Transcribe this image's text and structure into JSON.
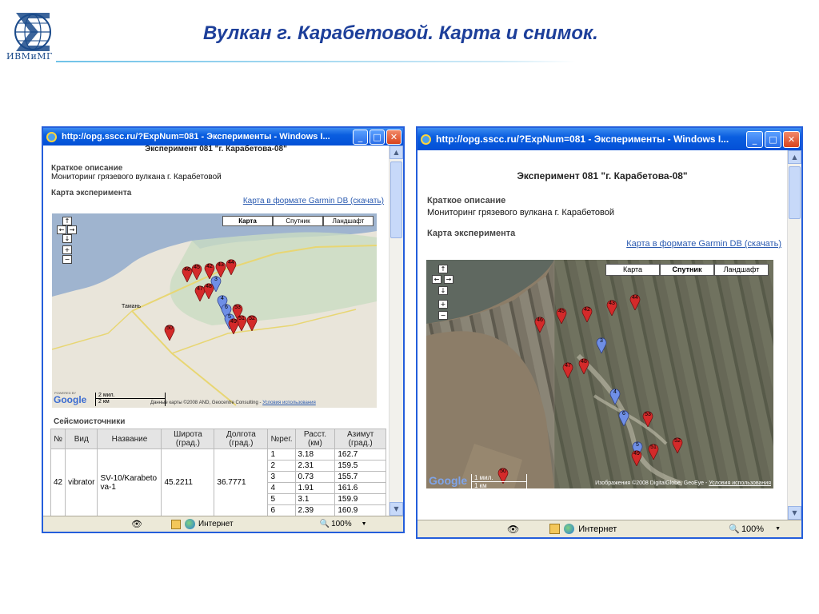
{
  "slide": {
    "title": "Вулкан г. Карабетовой. Карта и снимок.",
    "logo_text": "ИВМиМГ"
  },
  "browser": {
    "title": "http://opg.sscc.ru/?ExpNum=081 - Эксперименты - Windows I...",
    "status_zone": "Интернет",
    "zoom": "100%"
  },
  "page": {
    "heading": "Эксперимент 081 \"г. Карабетова-08\"",
    "desc_label": "Краткое описание",
    "desc_text": "Мониторинг грязевого вулкана г. Карабетовой",
    "map_label": "Карта эксперимента",
    "garmin_link": "Карта в формате Garmin DB (скачать)",
    "seismic_label": "Сейсмоисточники"
  },
  "map": {
    "types": [
      "Карта",
      "Спутник",
      "Ландшафт"
    ],
    "town_label": "Тамань",
    "powered_by": "POWERED BY",
    "google": "Google",
    "scale_left_top": "2 мил.",
    "scale_left_bottom": "2 км",
    "scale_right_top": "1 мил.",
    "scale_right_bottom": "1 км",
    "attribution_left": "Данные карты ©2008 AND, Geocentre Consulting -",
    "terms_left": "Условия использования",
    "attribution_right": "Изображения ©2008 DigitalGlobe, GeoEye -",
    "terms_right": "Условия использования",
    "selected_left": "Карта",
    "selected_right": "Спутник",
    "markers_red": [
      "46",
      "45",
      "42",
      "43",
      "44",
      "47",
      "48",
      "53",
      "51",
      "49",
      "52",
      "50"
    ],
    "markers_blue": [
      "3",
      "4",
      "5",
      "6"
    ]
  },
  "table": {
    "headers": [
      "№",
      "Вид",
      "Название",
      "Широта (град.)",
      "Долгота (град.)",
      "№рег.",
      "Расст. (км)",
      "Азимут (град.)"
    ],
    "row": {
      "num": "42",
      "kind": "vibrator",
      "name": "SV-10/Karabetova-1",
      "lat": "45.2211",
      "lon": "36.7771"
    },
    "sub_rows": [
      {
        "reg": "1",
        "dist": "3.18",
        "az": "162.7"
      },
      {
        "reg": "2",
        "dist": "2.31",
        "az": "159.5"
      },
      {
        "reg": "3",
        "dist": "0.73",
        "az": "155.7"
      },
      {
        "reg": "4",
        "dist": "1.91",
        "az": "161.6"
      },
      {
        "reg": "5",
        "dist": "3.1",
        "az": "159.9"
      },
      {
        "reg": "6",
        "dist": "2.39",
        "az": "160.9"
      }
    ]
  },
  "colors": {
    "slide_title": "#1d3f9a",
    "xp_blue": "#0a5ee0",
    "marker_red": "#d42a2a",
    "marker_blue": "#6f8fe6",
    "map_water": "#9fb4cf",
    "map_land": "#e8e4d8"
  },
  "icons": [
    "ie-icon",
    "minimize-icon",
    "maximize-icon",
    "close-icon",
    "internet-zone-icon",
    "zoom-icon"
  ]
}
